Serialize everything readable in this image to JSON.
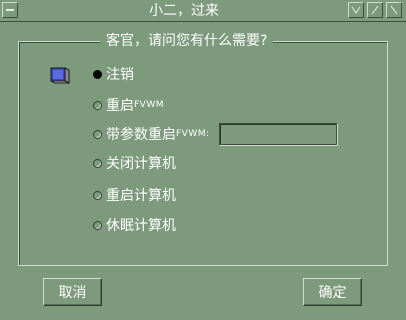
{
  "window": {
    "title": "小二，过来",
    "menu_icon": "window-menu-icon",
    "buttons": [
      "minimize-icon",
      "maximize-icon",
      "close-icon"
    ]
  },
  "dialog": {
    "question": "客官，请问您有什么需要?",
    "icon": "monitor-icon",
    "options": [
      {
        "label": "注销",
        "selected": true
      },
      {
        "label": "重启",
        "suffix": "FVWM",
        "selected": false
      },
      {
        "label": "带参数重启",
        "suffix": "FVWM:",
        "selected": false
      },
      {
        "label": "关闭计算机",
        "selected": false
      },
      {
        "label": "重启计算机",
        "selected": false
      },
      {
        "label": "休眠计算机",
        "selected": false
      }
    ],
    "params_value": "",
    "cancel_label": "取消",
    "ok_label": "确定"
  },
  "colors": {
    "background": "#7d9a7d",
    "text": "#ffffff",
    "shadow": "#3c4f3c",
    "highlight": "#cfdccf"
  }
}
